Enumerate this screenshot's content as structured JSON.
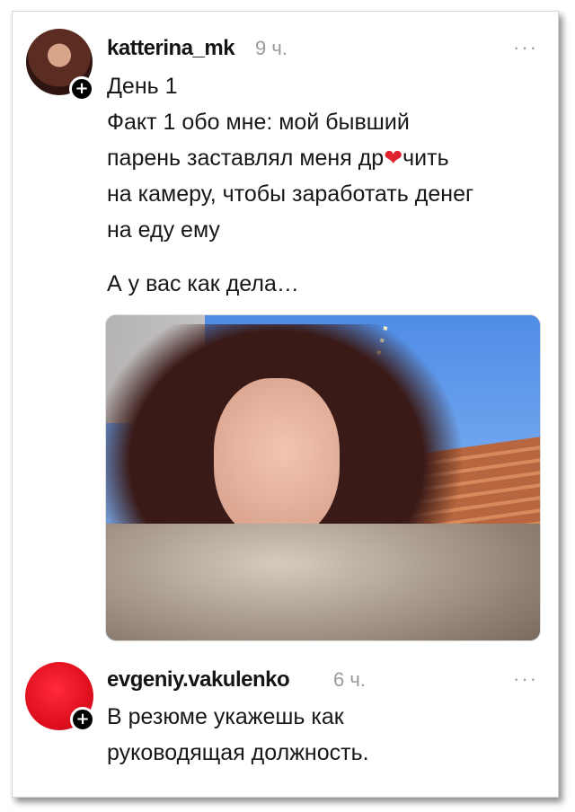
{
  "post": {
    "username": "katterina_mk",
    "time": "9 ч.",
    "more_icon": "more-icon",
    "lines": [
      "День 1",
      "Факт 1 обо мне: мой бывший",
      "парень заставлял меня др",
      "чить",
      "на камеру, чтобы заработать денег",
      "на еду ему",
      "А у вас как дела…"
    ],
    "heart_icon": "❤",
    "follow_badge": "+"
  },
  "reply": {
    "username": "evgeniy.vakulenko",
    "time": "6 ч.",
    "lines": [
      "В резюме укажешь как",
      "руководящая должность."
    ],
    "follow_badge": "+"
  },
  "colors": {
    "heart": "#e0212f",
    "avatar_red": "#e0101f"
  }
}
